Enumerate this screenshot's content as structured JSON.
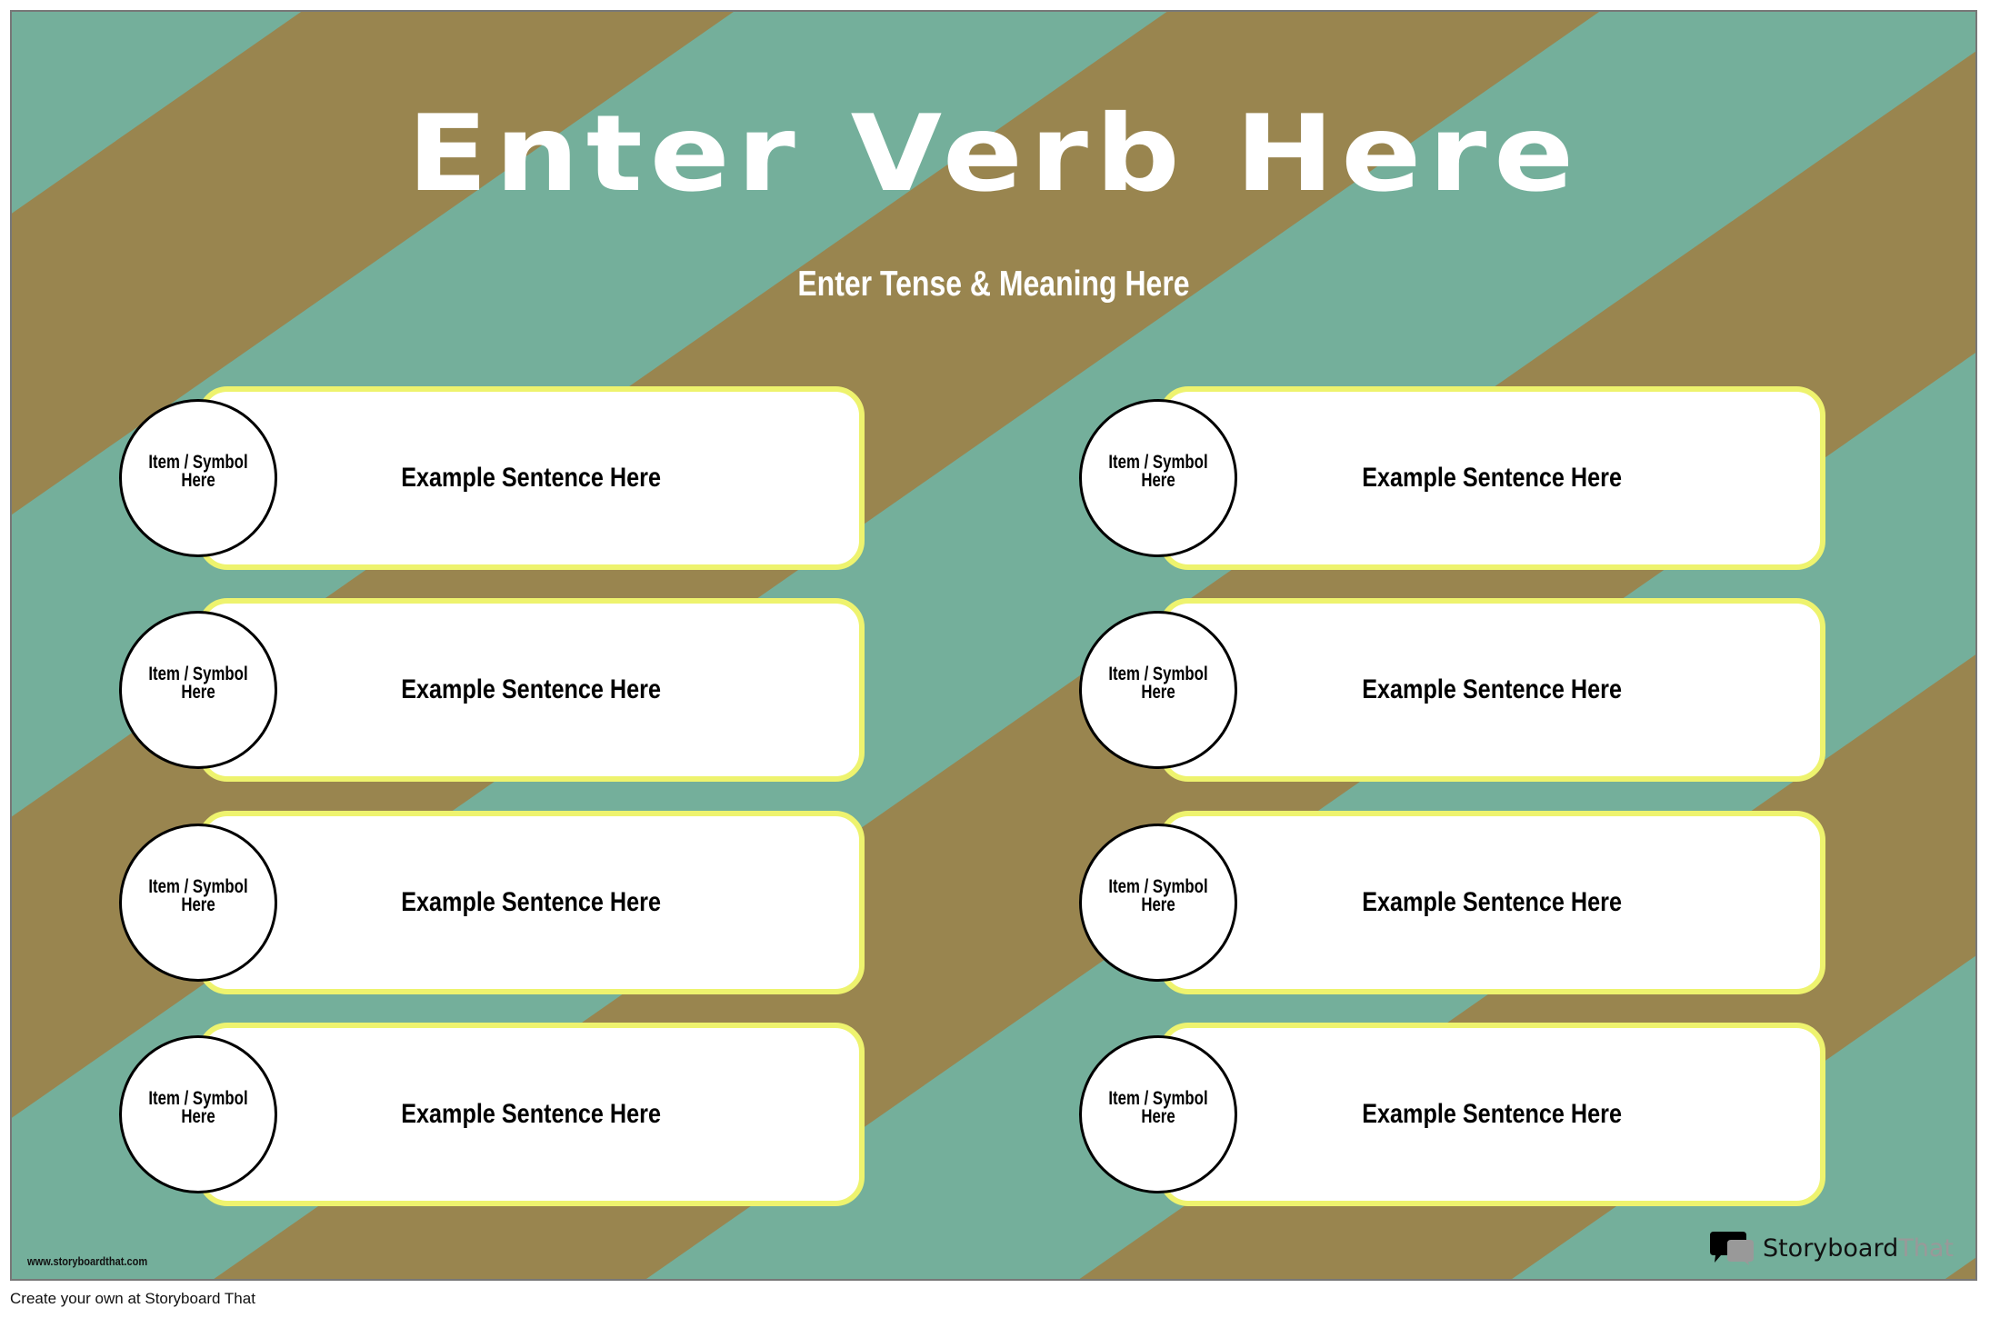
{
  "poster": {
    "title": "Enter Verb Here",
    "subtitle": "Enter Tense & Meaning Here",
    "colors": {
      "background_teal": "#74AF9B",
      "stripe_brown": "#99854F",
      "card_border_yellow": "#EEF36E",
      "text_white": "#FFFFFF"
    },
    "cards": [
      {
        "symbol": "Item / Symbol Here",
        "sentence": "Example Sentence Here"
      },
      {
        "symbol": "Item / Symbol Here",
        "sentence": "Example Sentence Here"
      },
      {
        "symbol": "Item / Symbol Here",
        "sentence": "Example Sentence Here"
      },
      {
        "symbol": "Item / Symbol Here",
        "sentence": "Example Sentence Here"
      },
      {
        "symbol": "Item / Symbol Here",
        "sentence": "Example Sentence Here"
      },
      {
        "symbol": "Item / Symbol Here",
        "sentence": "Example Sentence Here"
      },
      {
        "symbol": "Item / Symbol Here",
        "sentence": "Example Sentence Here"
      },
      {
        "symbol": "Item / Symbol Here",
        "sentence": "Example Sentence Here"
      }
    ],
    "watermark_url": "www.storyboardthat.com",
    "logo": {
      "icon": "speech-bubbles-icon",
      "brand_primary": "Storyboard",
      "brand_secondary": "That"
    }
  },
  "footer": {
    "text": "Create your own at Storyboard That"
  }
}
